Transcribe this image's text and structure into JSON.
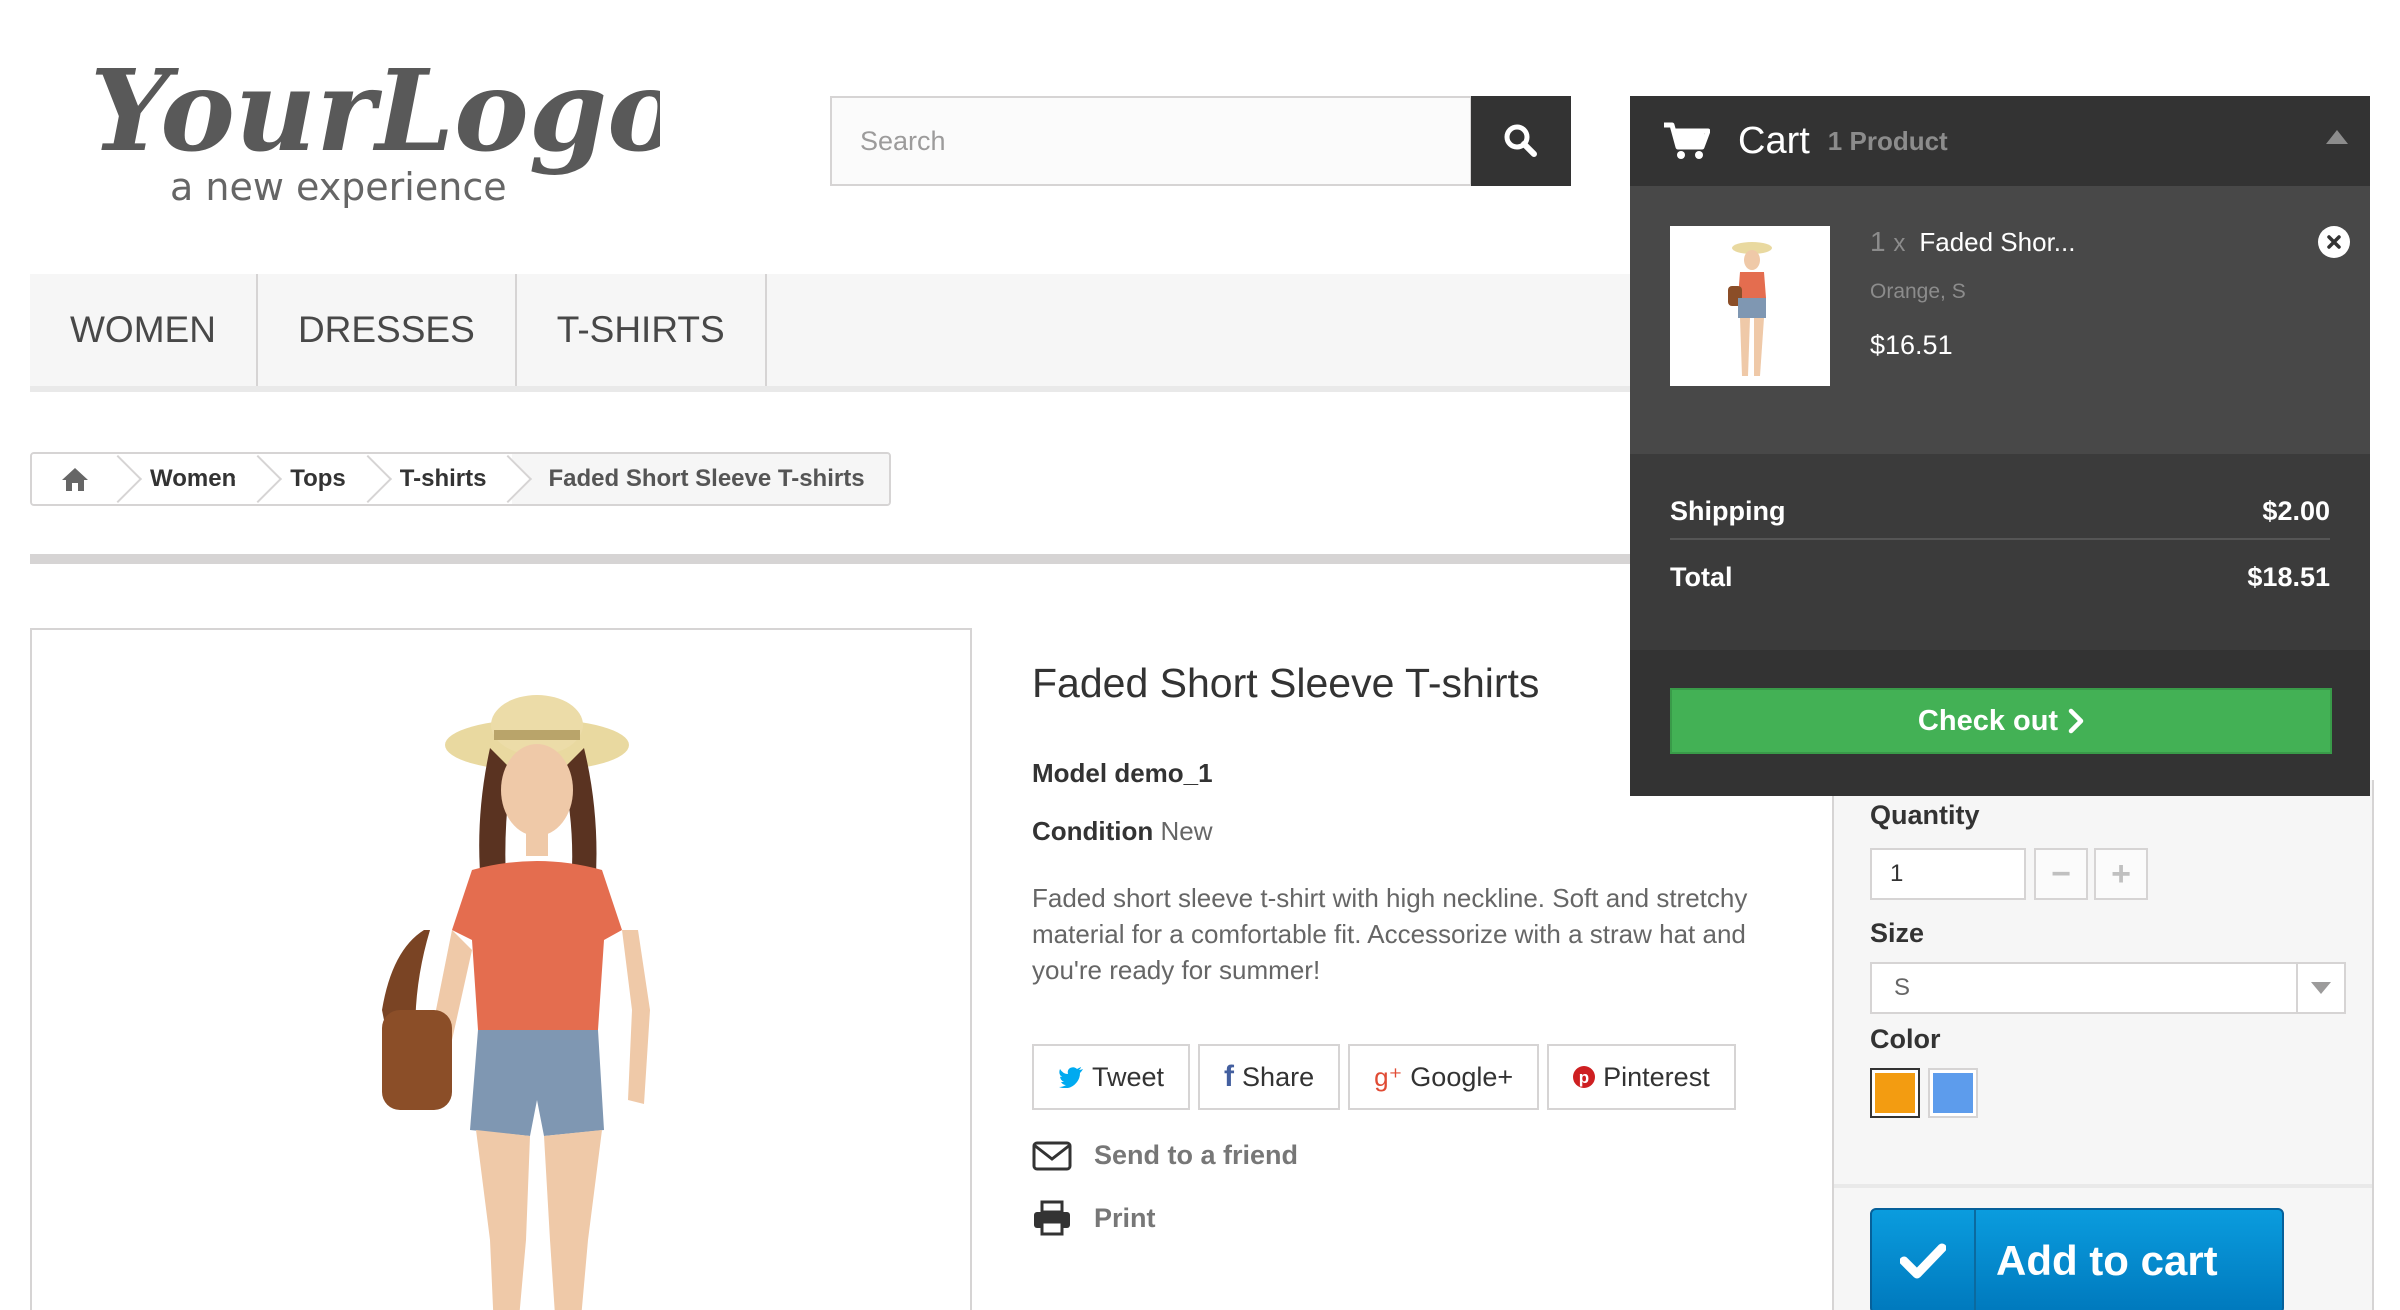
{
  "logo": {
    "text": "YourLogo",
    "tagline": "a new experience"
  },
  "search": {
    "placeholder": "Search"
  },
  "menu": {
    "items": [
      {
        "label": "WOMEN"
      },
      {
        "label": "DRESSES"
      },
      {
        "label": "T-SHIRTS"
      }
    ]
  },
  "breadcrumb": {
    "items": [
      {
        "label": "Women"
      },
      {
        "label": "Tops"
      },
      {
        "label": "T-shirts"
      }
    ],
    "current": "Faded Short Sleeve T-shirts"
  },
  "product": {
    "title": "Faded Short Sleeve T-shirts",
    "model_label": "Model",
    "model_value": "demo_1",
    "condition_label": "Condition",
    "condition_value": "New",
    "description": "Faded short sleeve t-shirt with high neckline. Soft and stretchy material for a comfortable fit. Accessorize with a straw hat and you're ready for summer!"
  },
  "social": {
    "tweet": "Tweet",
    "share": "Share",
    "google": "Google+",
    "pinterest": "Pinterest"
  },
  "actions": {
    "send_friend": "Send to a friend",
    "print": "Print"
  },
  "buy": {
    "quantity_label": "Quantity",
    "quantity_value": "1",
    "size_label": "Size",
    "size_value": "S",
    "color_label": "Color",
    "colors": [
      "#f39c11",
      "#5d9cec"
    ],
    "add_to_cart": "Add to cart"
  },
  "cart": {
    "title": "Cart",
    "count": "1 Product",
    "item": {
      "qty": "1",
      "qty_x": "x",
      "name": "Faded Shor...",
      "attributes": "Orange, S",
      "price": "$16.51"
    },
    "shipping_label": "Shipping",
    "shipping_value": "$2.00",
    "total_label": "Total",
    "total_value": "$18.51",
    "checkout": "Check out"
  },
  "colors": {
    "dark": "#333333",
    "panel": "#484848",
    "checkout_green": "#43b155",
    "cart_blue": "#0a9cde",
    "twitter": "#00aaf0",
    "facebook": "#435f9f",
    "google": "#e04b34",
    "pinterest": "#ce1f21"
  }
}
